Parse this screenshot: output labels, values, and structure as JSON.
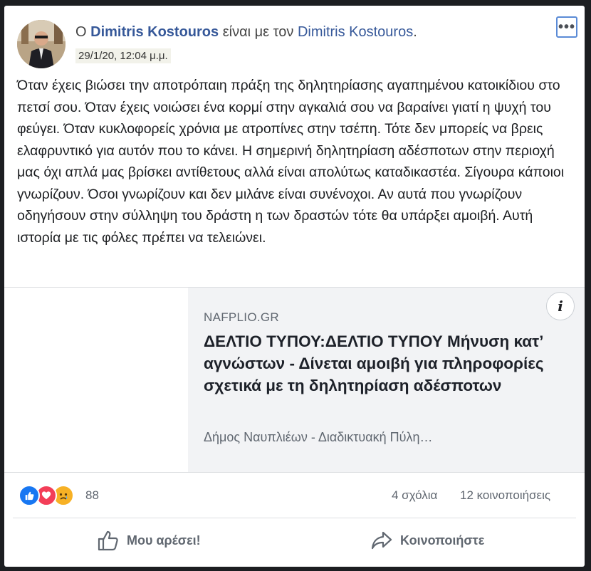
{
  "header": {
    "prefix": "Ο",
    "author": "Dimitris Kostouros",
    "connector": "είναι με τον",
    "tagged": "Dimitris Kostouros",
    "suffix": ".",
    "timestamp": "29/1/20, 12:04 μ.μ.",
    "more_label": "•••"
  },
  "post": {
    "text": "Όταν έχεις βιώσει την αποτρόπαιη πράξη της δηλητηρίασης αγαπημένου κατοικίδιου στο πετσί σου. Όταν έχεις νοιώσει ένα κορμί στην αγκαλιά σου να βαραίνει γιατί η ψυχή του φεύγει. Όταν κυκλοφορείς χρόνια με ατροπίνες στην τσέπη. Τότε δεν μπορείς να βρεις ελαφρυντικό για αυτόν που το κάνει. Η σημερινή δηλητηρίαση αδέσποτων στην περιοχή μας όχι απλά μας βρίσκει αντίθετους αλλά είναι απολύτως καταδικαστέα. Σίγουρα κάποιοι γνωρίζουν. Όσοι γνωρίζουν και δεν μιλάνε είναι συνένοχοι. Αν αυτά που γνωρίζουν οδηγήσουν στην σύλληψη του δράστη η των δραστών τότε θα υπάρξει αμοιβή. Αυτή ιστορία με τις φόλες πρέπει να τελειώνει."
  },
  "link_preview": {
    "domain": "NAFPLIO.GR",
    "title": "ΔΕΛΤΙΟ ΤΥΠΟΥ:ΔΕΛΤΙΟ ΤΥΠΟΥ Μήνυση κατ’ αγνώστων - Δίνεται αμοιβή για πληροφορίες σχετικά με τη δηλητηρίαση αδέσποτων",
    "description": "Δήμος Ναυπλιέων - Διαδικτυακή Πύλη…",
    "info_label": "i"
  },
  "stats": {
    "reaction_count": "88",
    "comments": "4 σχόλια",
    "shares": "12 κοινοποιήσεις",
    "reaction_icons": [
      "like-icon",
      "love-icon",
      "sad-icon"
    ]
  },
  "actions": {
    "like_label": "Μου αρέσει!",
    "share_label": "Κοινοποιήστε"
  },
  "colors": {
    "link": "#365899",
    "like": "#1877f2",
    "love": "#f33e58",
    "sad": "#f7b125"
  }
}
